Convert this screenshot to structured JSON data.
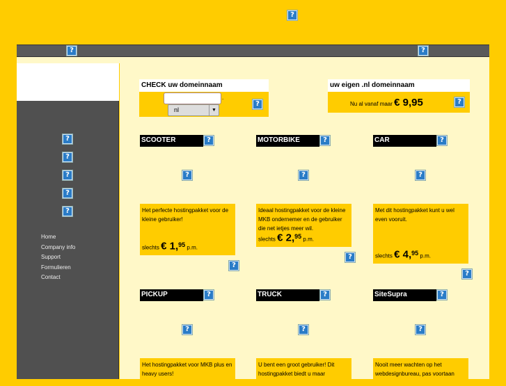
{
  "domain_check": {
    "title": "CHECK uw domeinnaam",
    "input_value": "",
    "tld_selected": "nl",
    "dot": "."
  },
  "own_domain": {
    "title": "uw eigen .nl domeinnaam",
    "prefix": "Nu al vanaf maar",
    "price": "€ 9,95"
  },
  "sidebar": {
    "menu": [
      "Home",
      "Company info",
      "Support",
      "Formulieren",
      "Contact"
    ]
  },
  "packages": [
    {
      "name": "SCOOTER",
      "desc": "Het perfecte hostingpakket voor de kleine gebruiker!",
      "pre": "slechts",
      "price": "€ 1,",
      "cents": "95",
      "post": "p.m."
    },
    {
      "name": "MOTORBIKE",
      "desc": "Ideaal hostingpakket voor de kleine MKB ondernemer en de gebruiker die net ietjes meer wil.",
      "pre": "slechts",
      "price": "€ 2,",
      "cents": "95",
      "post": "p.m."
    },
    {
      "name": "CAR",
      "desc": "Met dit hostingpakket kunt u wel even vooruit.",
      "pre": "slechts",
      "price": "€ 4,",
      "cents": "95",
      "post": "p.m."
    },
    {
      "name": "PICKUP",
      "desc": "Het hostingpakket voor MKB plus en heavy users!"
    },
    {
      "name": "TRUCK",
      "desc": "U bent een groot gebruiker! Dit hostingpakket biedt u maar"
    },
    {
      "name": "SiteSupra",
      "desc": "Nooit meer wachten op het webdesignbureau, pas voortaan"
    }
  ],
  "colors": {
    "brand": "#FFCC00",
    "content_bg": "#FFF8C8",
    "sidebar": "#505050"
  },
  "icons": {
    "placeholder": "broken-image-icon",
    "glyph": "?"
  }
}
